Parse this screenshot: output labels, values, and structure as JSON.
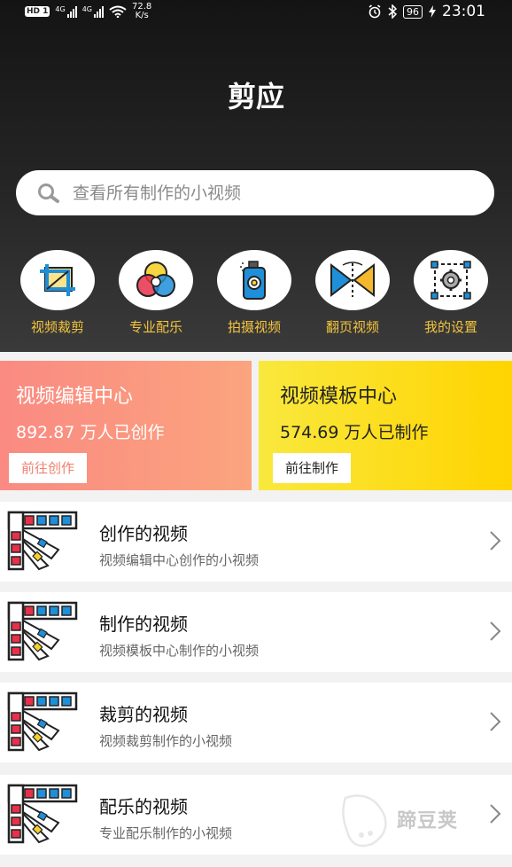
{
  "status_bar": {
    "hd_label": "HD",
    "hd_sim": "1",
    "network_1": "4G",
    "network_2": "4G",
    "speed_value": "72.8",
    "speed_unit": "K/s",
    "battery": "96",
    "time": "23:01"
  },
  "app": {
    "title": "剪应"
  },
  "search": {
    "placeholder": "查看所有制作的小视频",
    "icon": "search-icon"
  },
  "features": [
    {
      "label": "视频裁剪",
      "icon": "crop-icon"
    },
    {
      "label": "专业配乐",
      "icon": "color-circles-icon"
    },
    {
      "label": "拍摄视频",
      "icon": "camera-spray-icon"
    },
    {
      "label": "翻页视频",
      "icon": "page-flip-icon"
    },
    {
      "label": "我的设置",
      "icon": "settings-gear-icon"
    }
  ],
  "promos": [
    {
      "title": "视频编辑中心",
      "count": "892.87 万人已创作",
      "button": "前往创作",
      "gradient": [
        "#fa8a82",
        "#fba47e"
      ]
    },
    {
      "title": "视频模板中心",
      "count": "574.69 万人已制作",
      "button": "前往制作",
      "gradient": [
        "#f9e83d",
        "#ffd400"
      ]
    }
  ],
  "list": [
    {
      "title": "创作的视频",
      "subtitle": "视频编辑中心创作的小视频",
      "icon": "color-palette-icon"
    },
    {
      "title": "制作的视频",
      "subtitle": "视频模板中心制作的小视频",
      "icon": "color-palette-icon"
    },
    {
      "title": "裁剪的视频",
      "subtitle": "视频裁剪制作的小视频",
      "icon": "color-palette-icon"
    },
    {
      "title": "配乐的视频",
      "subtitle": "专业配乐制作的小视频",
      "icon": "color-palette-icon"
    }
  ],
  "watermark": {
    "text": "蹄豆荚"
  },
  "colors": {
    "accent_yellow": "#f3c43f",
    "header_dark": "#1f1f1f",
    "coral": "#fa8a82",
    "yellow": "#ffd400"
  }
}
